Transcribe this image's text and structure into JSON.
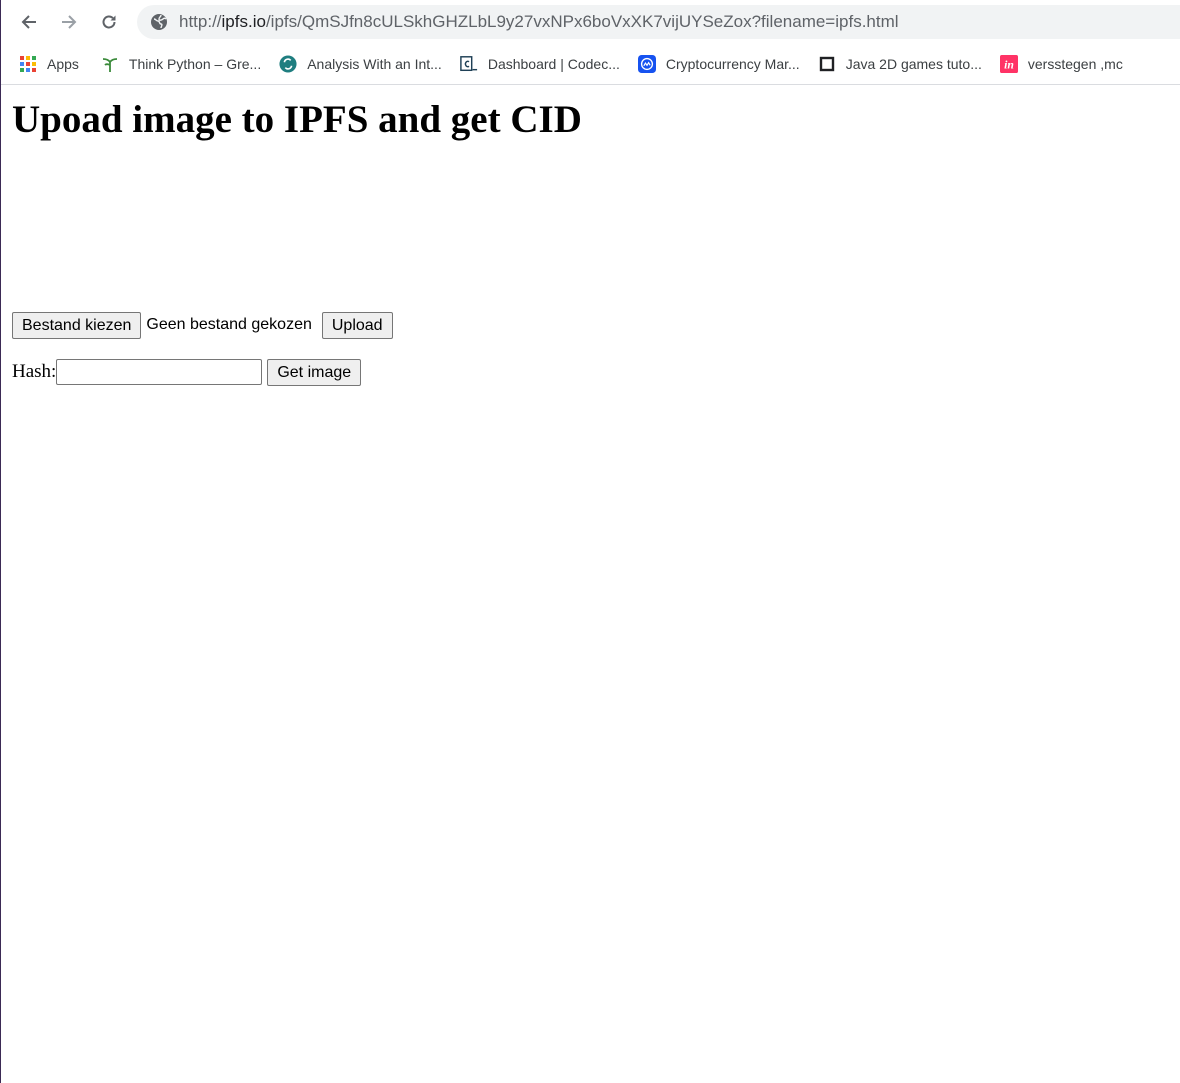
{
  "browser": {
    "url_scheme": "http://",
    "url_host": "ipfs.io",
    "url_path": "/ipfs/QmSJfn8cULSkhGHZLbL9y27vxNPx6boVxXK7vijUYSeZox?filename=ipfs.html"
  },
  "bookmarks": [
    {
      "label": "Apps",
      "icon": "apps-grid-icon"
    },
    {
      "label": "Think Python – Gre...",
      "icon": "green-tea-press-icon"
    },
    {
      "label": "Analysis With an Int...",
      "icon": "teal-circle-icon"
    },
    {
      "label": "Dashboard | Codec...",
      "icon": "codecademy-icon"
    },
    {
      "label": "Cryptocurrency Mar...",
      "icon": "coinmarketcap-icon"
    },
    {
      "label": "Java 2D games tuto...",
      "icon": "square-outline-icon"
    },
    {
      "label": "versstegen ,mc",
      "icon": "invision-icon"
    }
  ],
  "page": {
    "title": "Upoad image to IPFS and get CID",
    "choose_file_label": "Bestand kiezen",
    "file_status": "Geen bestand gekozen",
    "upload_label": "Upload",
    "hash_label": "Hash:",
    "hash_value": "",
    "get_image_label": "Get image"
  },
  "colors": {
    "omnibox_bg": "#f1f3f4",
    "invision_pink": "#ff3366",
    "coinmarketcap_blue": "#1652f0"
  }
}
